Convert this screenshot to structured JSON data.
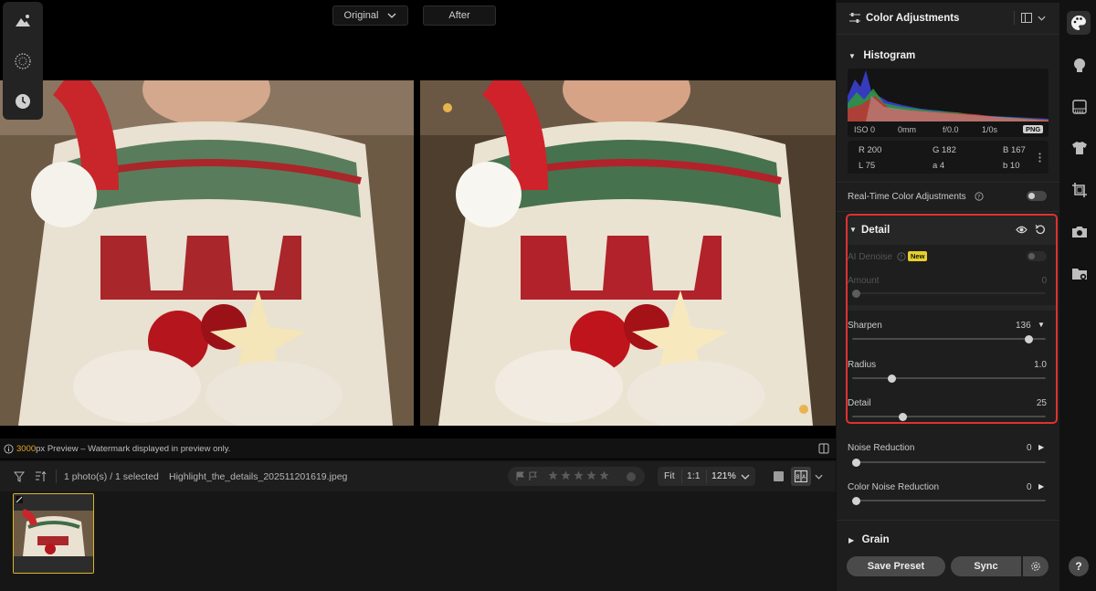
{
  "compare": {
    "original_label": "Original",
    "after_label": "After"
  },
  "preview_note": {
    "size": "3000",
    "text": "px Preview – Watermark displayed in preview only."
  },
  "film_bar": {
    "selection": "1 photo(s) / 1 selected",
    "filename": "Highlight_the_details_202511201619.jpeg",
    "fit_label": "Fit",
    "ratio_label": "1:1",
    "zoom": "121%",
    "rating": 0,
    "max_rating": 5
  },
  "panel": {
    "title": "Color Adjustments",
    "histogram": {
      "title": "Histogram",
      "exif": [
        "ISO 0",
        "0mm",
        "f/0.0",
        "1/0s"
      ],
      "format_badge": "PNG",
      "readout": {
        "r": "R 200",
        "g": "G 182",
        "b": "B 167",
        "l": "L 75",
        "a": "a 4",
        "bb": "b 10"
      }
    },
    "realtime_label": "Real-Time Color Adjustments",
    "detail": {
      "title": "Detail",
      "ai_denoise_label": "AI Denoise",
      "new_badge": "New",
      "amount": {
        "label": "Amount",
        "value": "0",
        "fraction": 0
      },
      "sharpen": {
        "label": "Sharpen",
        "value": "136",
        "fraction": 0.93
      },
      "radius": {
        "label": "Radius",
        "value": "1.0",
        "fraction": 0.19
      },
      "detail_slider": {
        "label": "Detail",
        "value": "25",
        "fraction": 0.25
      }
    },
    "noise_reduction": {
      "label": "Noise Reduction",
      "value": "0",
      "fraction": 0
    },
    "color_noise_reduction": {
      "label": "Color Noise Reduction",
      "value": "0",
      "fraction": 0
    },
    "grain": {
      "title": "Grain"
    },
    "save_preset_label": "Save Preset",
    "sync_label": "Sync"
  },
  "rail": {
    "help_label": "?"
  },
  "colors": {
    "accent_red": "#e0312f",
    "selection_gold": "#d9b629",
    "watermark_orange": "#e4a727"
  },
  "icons": [
    "photo-icon",
    "grain-icon",
    "history-icon",
    "chevron-down-icon",
    "info-icon",
    "compare-split-icon",
    "filter-icon",
    "sort-icon",
    "flag-icon",
    "star-icon",
    "single-view-icon",
    "before-after-icon",
    "sliders-icon",
    "panel-layout-icon",
    "eye-icon",
    "reset-icon",
    "more-icon",
    "gear-icon",
    "palette-icon",
    "portrait-icon",
    "texture-icon",
    "shirt-icon",
    "crop-icon",
    "camera-icon",
    "folder-icon"
  ]
}
